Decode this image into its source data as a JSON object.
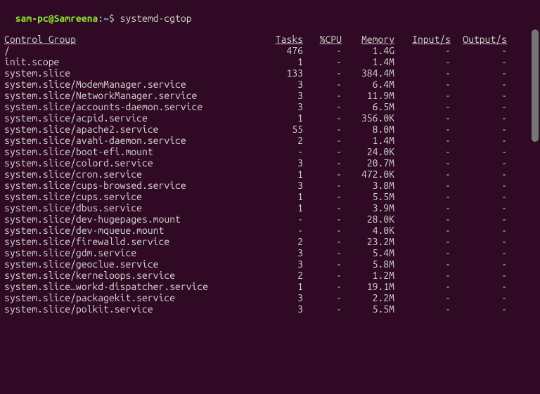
{
  "prompt": {
    "userhost": "sam-pc@Samreena",
    "colon": ":",
    "path": "~",
    "dollar": "$ ",
    "command": "systemd-cgtop"
  },
  "headers": {
    "name": "Control Group",
    "tasks": "Tasks",
    "cpu": "%CPU",
    "memory": "Memory",
    "input": "Input/s",
    "output": "Output/s"
  },
  "rows": [
    {
      "name": "/",
      "tasks": "476",
      "cpu": "-",
      "memory": "1.4G",
      "input": "-",
      "output": "-"
    },
    {
      "name": "init.scope",
      "tasks": "1",
      "cpu": "-",
      "memory": "1.4M",
      "input": "-",
      "output": "-"
    },
    {
      "name": "system.slice",
      "tasks": "133",
      "cpu": "-",
      "memory": "384.4M",
      "input": "-",
      "output": "-"
    },
    {
      "name": "system.slice/ModemManager.service",
      "tasks": "3",
      "cpu": "-",
      "memory": "6.4M",
      "input": "-",
      "output": "-"
    },
    {
      "name": "system.slice/NetworkManager.service",
      "tasks": "3",
      "cpu": "-",
      "memory": "11.9M",
      "input": "-",
      "output": "-"
    },
    {
      "name": "system.slice/accounts-daemon.service",
      "tasks": "3",
      "cpu": "-",
      "memory": "6.5M",
      "input": "-",
      "output": "-"
    },
    {
      "name": "system.slice/acpid.service",
      "tasks": "1",
      "cpu": "-",
      "memory": "356.0K",
      "input": "-",
      "output": "-"
    },
    {
      "name": "system.slice/apache2.service",
      "tasks": "55",
      "cpu": "-",
      "memory": "8.0M",
      "input": "-",
      "output": "-"
    },
    {
      "name": "system.slice/avahi-daemon.service",
      "tasks": "2",
      "cpu": "-",
      "memory": "1.4M",
      "input": "-",
      "output": "-"
    },
    {
      "name": "system.slice/boot-efi.mount",
      "tasks": "-",
      "cpu": "-",
      "memory": "24.0K",
      "input": "-",
      "output": "-"
    },
    {
      "name": "system.slice/colord.service",
      "tasks": "3",
      "cpu": "-",
      "memory": "20.7M",
      "input": "-",
      "output": "-"
    },
    {
      "name": "system.slice/cron.service",
      "tasks": "1",
      "cpu": "-",
      "memory": "472.0K",
      "input": "-",
      "output": "-"
    },
    {
      "name": "system.slice/cups-browsed.service",
      "tasks": "3",
      "cpu": "-",
      "memory": "3.8M",
      "input": "-",
      "output": "-"
    },
    {
      "name": "system.slice/cups.service",
      "tasks": "1",
      "cpu": "-",
      "memory": "5.5M",
      "input": "-",
      "output": "-"
    },
    {
      "name": "system.slice/dbus.service",
      "tasks": "1",
      "cpu": "-",
      "memory": "3.9M",
      "input": "-",
      "output": "-"
    },
    {
      "name": "system.slice/dev-hugepages.mount",
      "tasks": "-",
      "cpu": "-",
      "memory": "28.0K",
      "input": "-",
      "output": "-"
    },
    {
      "name": "system.slice/dev-mqueue.mount",
      "tasks": "-",
      "cpu": "-",
      "memory": "4.0K",
      "input": "-",
      "output": "-"
    },
    {
      "name": "system.slice/firewalld.service",
      "tasks": "2",
      "cpu": "-",
      "memory": "23.2M",
      "input": "-",
      "output": "-"
    },
    {
      "name": "system.slice/gdm.service",
      "tasks": "3",
      "cpu": "-",
      "memory": "5.4M",
      "input": "-",
      "output": "-"
    },
    {
      "name": "system.slice/geoclue.service",
      "tasks": "3",
      "cpu": "-",
      "memory": "5.8M",
      "input": "-",
      "output": "-"
    },
    {
      "name": "system.slice/kerneloops.service",
      "tasks": "2",
      "cpu": "-",
      "memory": "1.2M",
      "input": "-",
      "output": "-"
    },
    {
      "name": "system.slice…workd-dispatcher.service",
      "tasks": "1",
      "cpu": "-",
      "memory": "19.1M",
      "input": "-",
      "output": "-"
    },
    {
      "name": "system.slice/packagekit.service",
      "tasks": "3",
      "cpu": "-",
      "memory": "2.2M",
      "input": "-",
      "output": "-"
    },
    {
      "name": "system.slice/polkit.service",
      "tasks": "3",
      "cpu": "-",
      "memory": "5.5M",
      "input": "-",
      "output": "-"
    }
  ]
}
